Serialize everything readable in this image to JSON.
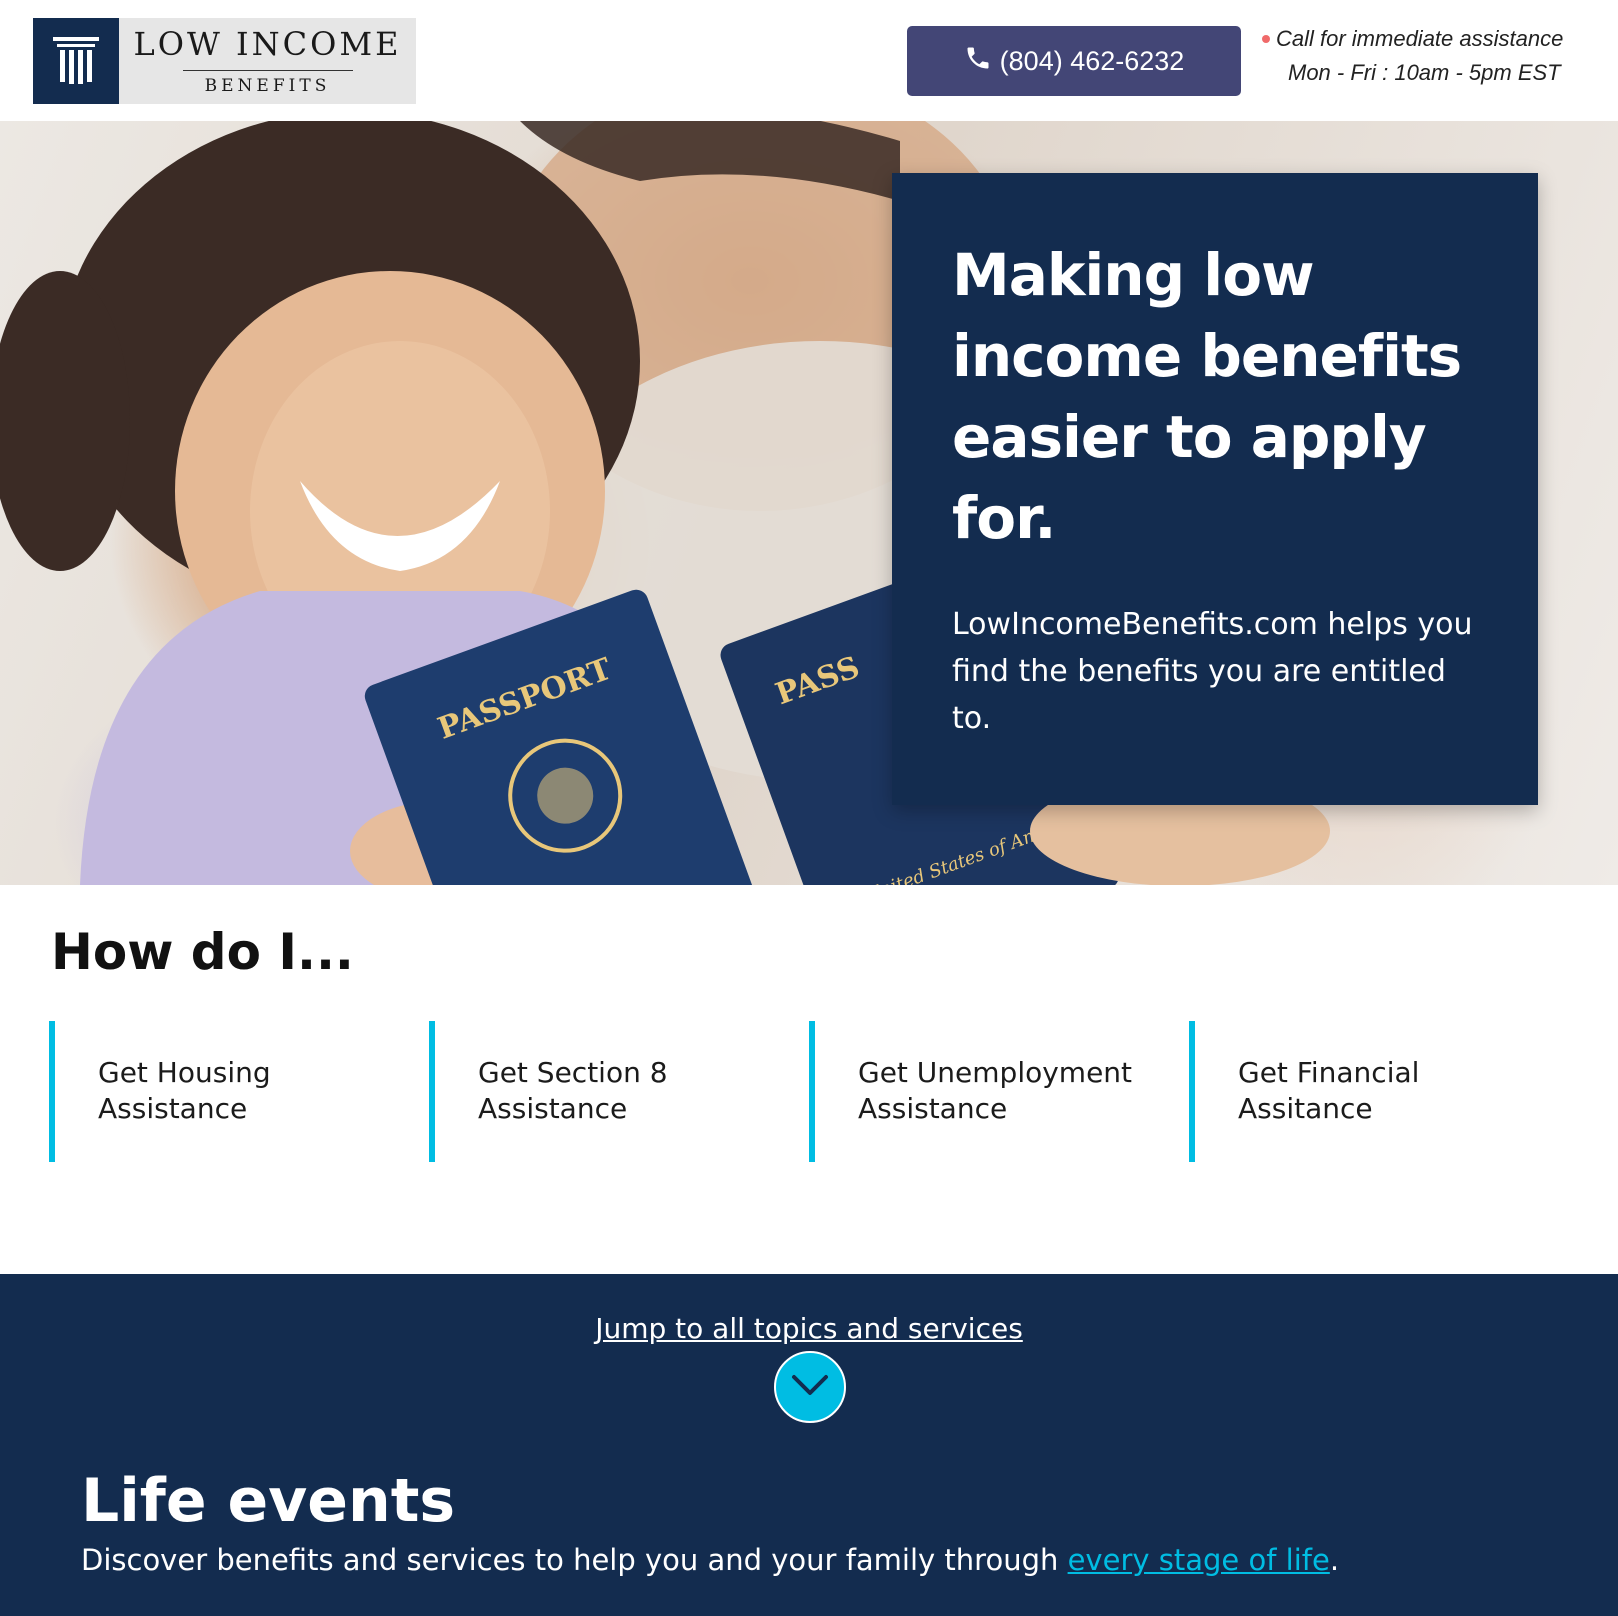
{
  "header": {
    "logo": {
      "line1": "LOW INCOME",
      "line2": "BENEFITS"
    },
    "phone_button": {
      "number": "(804) 462-6232",
      "icon": "phone-icon"
    },
    "assistance": {
      "line1": "Call for immediate assistance",
      "line2": "Mon - Fri : 10am - 5pm EST"
    }
  },
  "hero": {
    "title": "Making low income benefits easier to apply for.",
    "subtitle": "LowIncomeBenefits.com helps you find the benefits you are entitled to.",
    "photo_text": {
      "passport_left": "PASSPORT",
      "passport_right": "PASS",
      "country": "United States of America"
    }
  },
  "how_do_i": {
    "title": "How do I...",
    "items": [
      {
        "line1": "Get Housing",
        "line2": "Assistance"
      },
      {
        "line1": "Get Section 8",
        "line2": "Assistance"
      },
      {
        "line1": "Get Unemployment",
        "line2": "Assistance"
      },
      {
        "line1": "Get Financial",
        "line2": "Assitance"
      }
    ]
  },
  "life_events": {
    "jump_link": "Jump to all topics and services",
    "jump_icon": "chevron-down-icon",
    "title": "Life events",
    "description_prefix": "Discover benefits and services to help you and your family through ",
    "description_link": "every stage of life",
    "description_suffix": "."
  },
  "colors": {
    "navy": "#132c4f",
    "phone_button": "#434676",
    "accent_cyan": "#00bde3",
    "status_dot": "#f06a6a"
  }
}
